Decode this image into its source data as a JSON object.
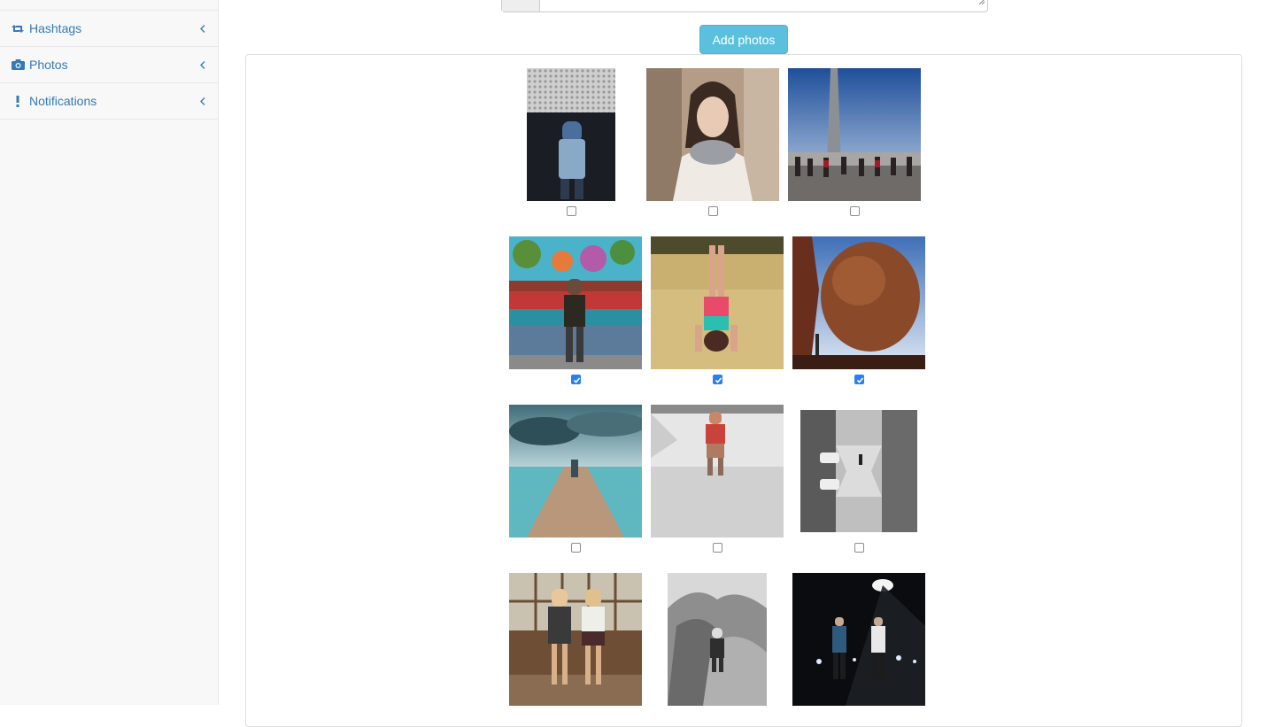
{
  "sidebar": {
    "items": [
      {
        "label": "Hashtags",
        "icon": "retweet-icon"
      },
      {
        "label": "Photos",
        "icon": "camera-icon"
      },
      {
        "label": "Notifications",
        "icon": "exclamation-icon"
      }
    ]
  },
  "main": {
    "add_button_label": "Add photos",
    "photos": [
      {
        "alt": "Man in blue shirt facing dark doorway",
        "selected": false
      },
      {
        "alt": "Woman with scarf in sweater",
        "selected": false
      },
      {
        "alt": "People standing before monument",
        "selected": false
      },
      {
        "alt": "Man in front of colorful mural",
        "selected": true
      },
      {
        "alt": "Person doing headstand on grass",
        "selected": true
      },
      {
        "alt": "Large balanced boulder",
        "selected": true
      },
      {
        "alt": "Person on wooden pier by the sea",
        "selected": false
      },
      {
        "alt": "Person standing in empty white pool",
        "selected": false
      },
      {
        "alt": "Mirrored black and white street",
        "selected": false
      },
      {
        "alt": "Two girls standing by window",
        "selected": false
      },
      {
        "alt": "Person in rocky landscape, black and white",
        "selected": false
      },
      {
        "alt": "Two people under street light at night",
        "selected": false
      }
    ]
  },
  "colors": {
    "accent": "#337ab7",
    "button": "#5bc0de",
    "checkbox_checked": "#2b7ff0"
  }
}
